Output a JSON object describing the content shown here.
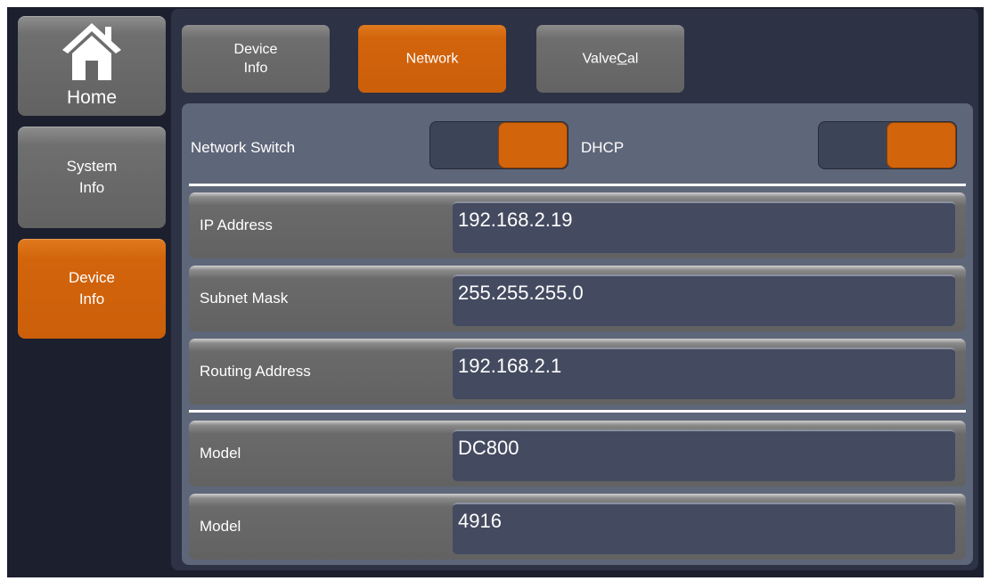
{
  "sidebar": {
    "home_label": "Home",
    "system_info_label": "System\nInfo",
    "device_info_label": "Device\nInfo"
  },
  "tabs": {
    "device_info_label": "Device\nInfo",
    "network_label": "Network",
    "valvecal_prefix": "Valve",
    "valvecal_underlined": "C",
    "valvecal_suffix": "al"
  },
  "network": {
    "network_switch_label": "Network Switch",
    "dhcp_label": "DHCP",
    "network_switch_state": "on",
    "dhcp_state": "on"
  },
  "fields": [
    {
      "label": "IP Address",
      "value": "192.168.2.19"
    },
    {
      "label": "Subnet Mask",
      "value": "255.255.255.0"
    },
    {
      "label": "Routing Address",
      "value": "192.168.2.1"
    },
    {
      "label": "Model",
      "value": "DC800"
    },
    {
      "label": "Model",
      "value": "4916"
    }
  ],
  "colors": {
    "accent": "#d2640c",
    "background": "#1b1f2e",
    "panel": "#5e6679",
    "button_gray": "#636363"
  }
}
